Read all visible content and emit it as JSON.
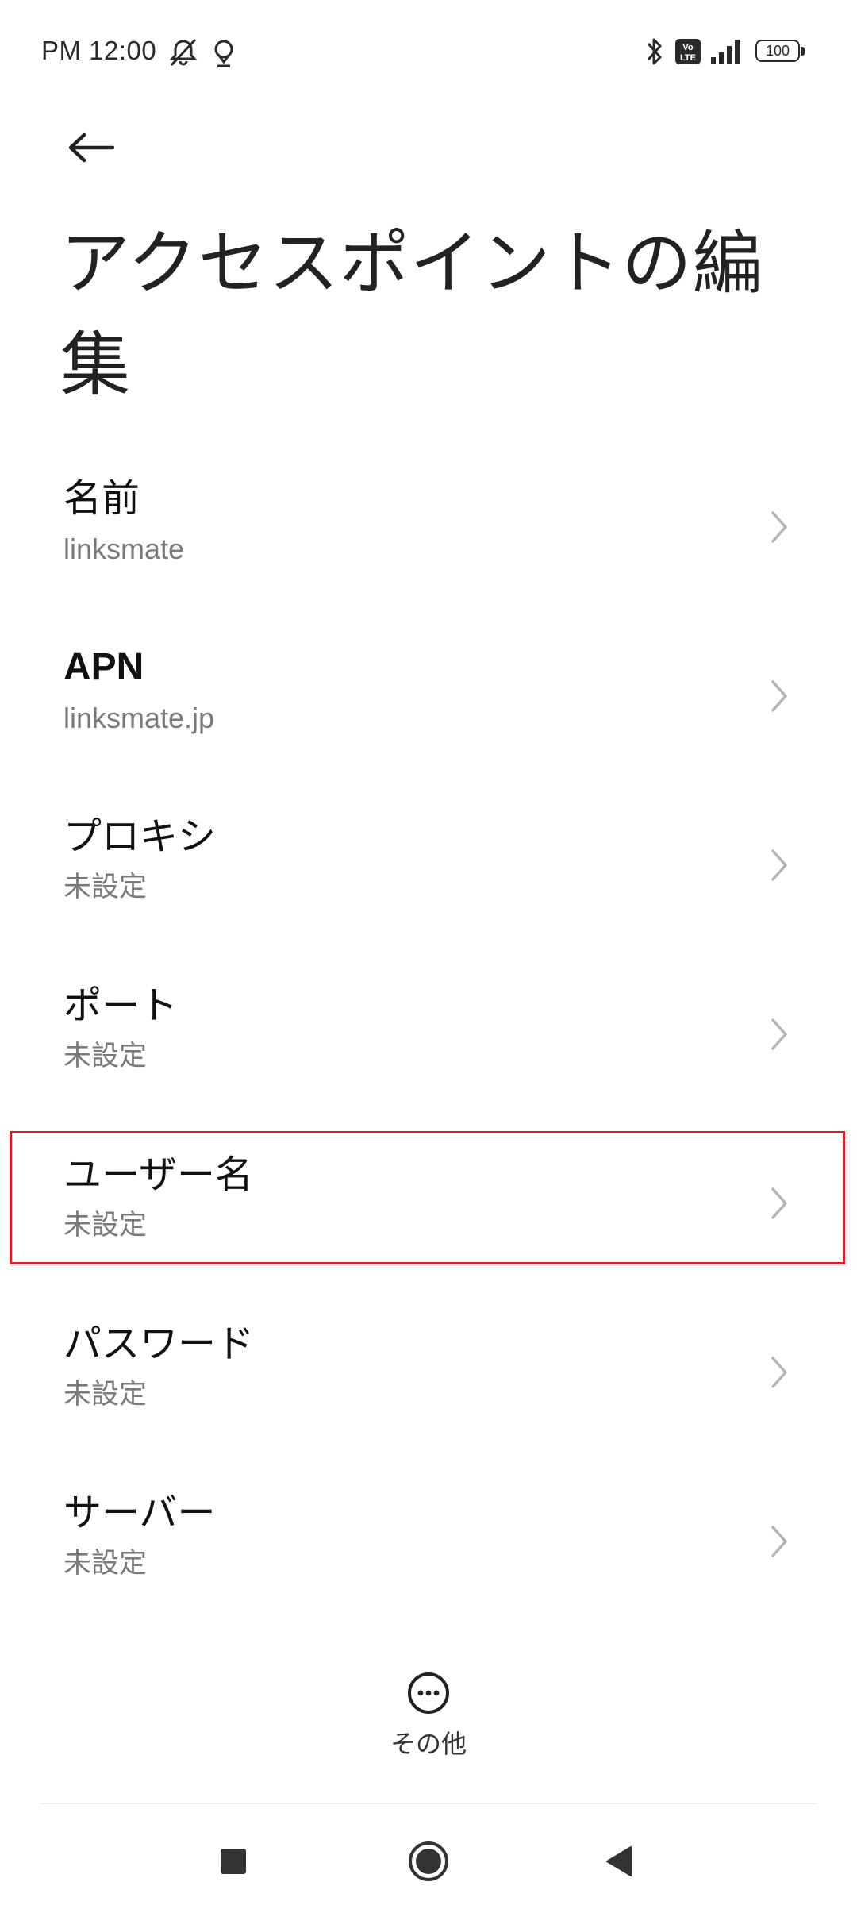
{
  "status_bar": {
    "time": "PM 12:00",
    "battery": "100",
    "icons": [
      "alarm-off-icon",
      "location-pin-icon",
      "bluetooth-icon",
      "volte-icon",
      "signal-icon",
      "battery-icon"
    ]
  },
  "header": {
    "back_icon": "arrow-left-icon",
    "title": "アクセスポイントの編集"
  },
  "settings": {
    "items": [
      {
        "label": "名前",
        "value": "linksmate"
      },
      {
        "label": "APN",
        "value": "linksmate.jp"
      },
      {
        "label": "プロキシ",
        "value": "未設定"
      },
      {
        "label": "ポート",
        "value": "未設定"
      },
      {
        "label": "ユーザー名",
        "value": "未設定",
        "highlighted": true
      },
      {
        "label": "パスワード",
        "value": "未設定"
      },
      {
        "label": "サーバー",
        "value": "未設定"
      }
    ]
  },
  "more": {
    "label": "その他",
    "icon": "more-horizontal-circle-icon"
  },
  "navigation": {
    "items": [
      "recents-square-icon",
      "home-circle-icon",
      "back-triangle-icon"
    ]
  },
  "colors": {
    "highlight": "#d0222d",
    "text_primary": "#111111",
    "text_secondary": "#7a7a7a"
  }
}
